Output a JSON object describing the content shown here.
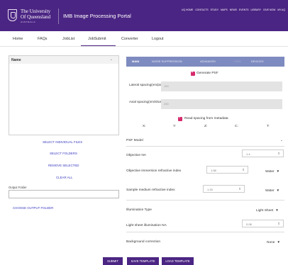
{
  "header": {
    "university_line1": "The University",
    "university_line2": "Of Queensland",
    "university_line3": "AUSTRALIA",
    "portal_title": "IMB Image Processing Portal",
    "top_links": [
      "UQ HOME",
      "CONTACTS",
      "STUDY",
      "MAPS",
      "NEWS",
      "EVENTS",
      "LIBRARY",
      "GIVE NOW",
      "MY.UQ"
    ]
  },
  "nav": {
    "items": [
      "Home",
      "FAQs",
      "JobList",
      "JobSubmit",
      "Converter",
      "Logout"
    ],
    "active": "JobSubmit"
  },
  "left": {
    "name_header": "Name",
    "links": {
      "select_files": "SELECT INDIVIDUAL FILES",
      "select_folders": "SELECT FOLDERS",
      "remove_selected": "REMOVE SELECTED",
      "clear_all": "CLEAR ALL"
    },
    "output_folder_label": "Output Folder",
    "choose_output": "CHOOSE OUTPUT FOLDER"
  },
  "tabs": [
    "MAIN",
    "NOISE SUPPRESSION",
    "ADVANCED",
    "ITEM",
    "DEVICES"
  ],
  "main": {
    "generate_psf": "Generate PSF",
    "lateral_label": "Lateral spacing(nm/pixel)",
    "lateral_value": "100",
    "axial_label": "Axial spacing(nm/slice)",
    "axial_value": "250",
    "read_spacing": "Read spacing from metadata",
    "axes": [
      "X:",
      "Y:",
      "Z:",
      "C:",
      "T:"
    ],
    "psf_model_label": "PSF Model",
    "objective_na_label": "Objective NA",
    "objective_na_value": "1.4",
    "immersion_label": "Objective immersion refractive index",
    "immersion_value": "1.58",
    "immersion_medium": "Water",
    "sample_label": "Sample medium refractive index",
    "sample_value": "1.33",
    "sample_medium": "Water",
    "illumination_label": "Illumination Type",
    "illumination_value": "Light Sheet",
    "lightsheet_label": "Light sheet illumination NA",
    "lightsheet_value": "0.08",
    "background_label": "Background correction",
    "background_value": "None"
  },
  "buttons": {
    "submit": "SUBMIT",
    "save_template": "SAVE TEMPLATE",
    "load_template": "LOAD TEMPLATE"
  },
  "colors": {
    "brand_purple": "#4b2583",
    "tab_blue": "#7e8bc0",
    "checkbox_pink": "#d62a6c",
    "link_blue": "#3a3ac0"
  }
}
